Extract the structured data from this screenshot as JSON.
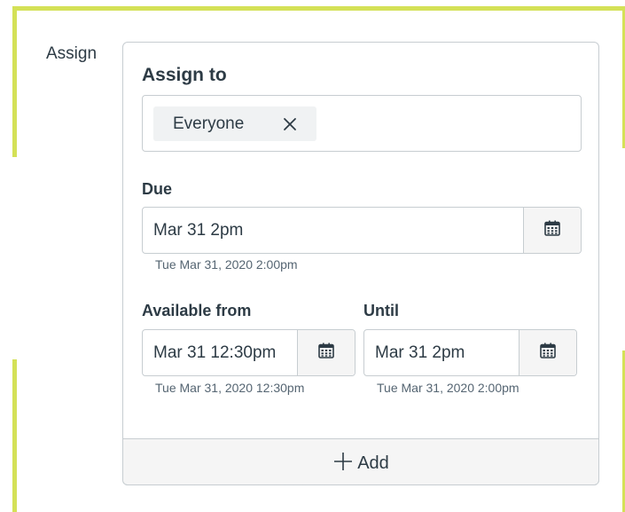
{
  "row_label": "Assign",
  "assign_to": {
    "heading": "Assign to",
    "tags": [
      {
        "label": "Everyone",
        "close_icon": "close-icon"
      }
    ]
  },
  "due": {
    "heading": "Due",
    "value": "Mar 31 2pm",
    "hint": "Tue Mar 31, 2020 2:00pm",
    "icon": "calendar-icon"
  },
  "available_from": {
    "heading": "Available from",
    "value": "Mar 31 12:30pm",
    "hint": "Tue Mar 31, 2020 12:30pm",
    "icon": "calendar-icon"
  },
  "until": {
    "heading": "Until",
    "value": "Mar 31 2pm",
    "hint": "Tue Mar 31, 2020 2:00pm",
    "icon": "calendar-icon"
  },
  "add": {
    "label": "Add",
    "icon": "plus-icon"
  },
  "colors": {
    "accent": "#d4e157",
    "text": "#2d3b45",
    "border": "#c7cdd1"
  }
}
